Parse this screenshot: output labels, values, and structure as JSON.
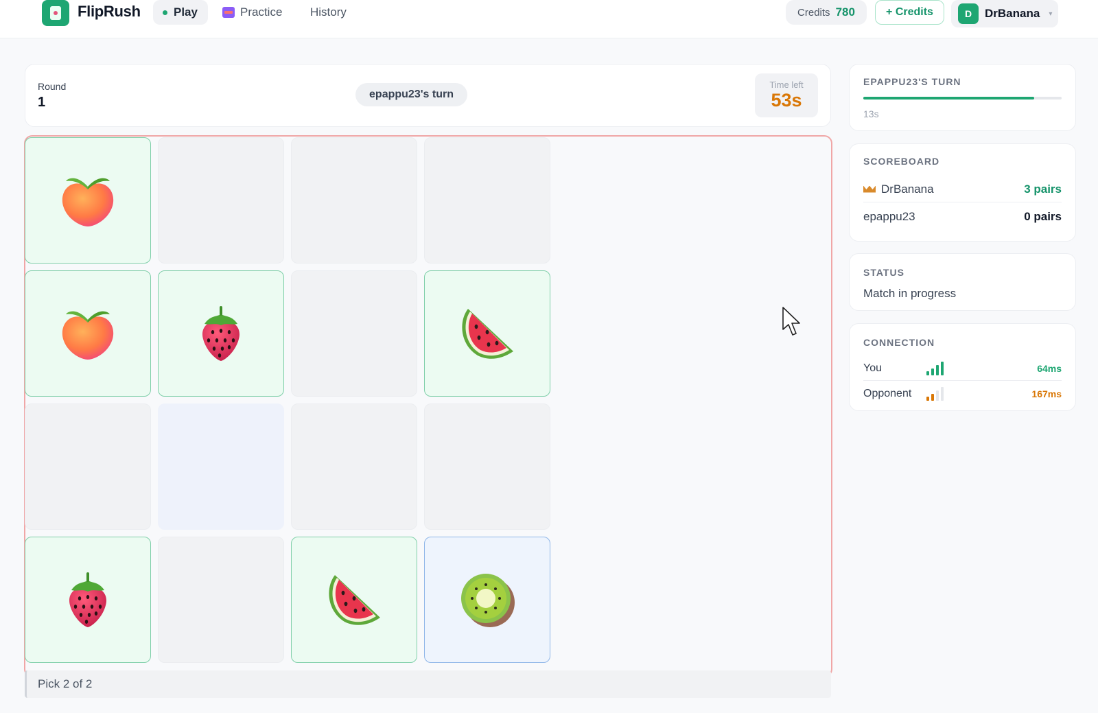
{
  "topbar": {
    "brand": "FlipRush",
    "nav": {
      "play": "Play",
      "practice": "Practice",
      "history": "History"
    },
    "credits_label": "Credits",
    "credits_value": "780",
    "add_credits_label": "+ Credits",
    "user_initial": "D",
    "user_name": "DrBanana"
  },
  "round": {
    "label": "Round",
    "value": "1",
    "turn": "epappu23's turn",
    "time_label": "Time left",
    "time_value": "53s"
  },
  "board": {
    "tiles": [
      {
        "state": "matched",
        "fruit": "peach"
      },
      {
        "state": "hidden"
      },
      {
        "state": "hidden"
      },
      {
        "state": "hidden"
      },
      {
        "state": "matched",
        "fruit": "peach"
      },
      {
        "state": "matched",
        "fruit": "strawberry"
      },
      {
        "state": "hidden"
      },
      {
        "state": "matched",
        "fruit": "watermelon"
      },
      {
        "state": "hidden"
      },
      {
        "state": "hover"
      },
      {
        "state": "hidden"
      },
      {
        "state": "hidden"
      },
      {
        "state": "matched",
        "fruit": "strawberry"
      },
      {
        "state": "hidden"
      },
      {
        "state": "matched",
        "fruit": "watermelon"
      },
      {
        "state": "selected",
        "fruit": "kiwi"
      }
    ],
    "pick_status": "Pick 2 of 2"
  },
  "sidebar": {
    "turn": {
      "title": "EPAPPU23'S TURN",
      "progress": 0.86,
      "seconds": "13s"
    },
    "scoreboard": {
      "title": "SCOREBOARD",
      "rows": [
        {
          "name": "DrBanana",
          "score": "3 pairs",
          "leader": true
        },
        {
          "name": "epappu23",
          "score": "0 pairs",
          "leader": false
        }
      ]
    },
    "status": {
      "title": "STATUS",
      "text": "Match in progress"
    },
    "connection": {
      "title": "CONNECTION",
      "rows": [
        {
          "label": "You",
          "latency": "64ms",
          "bars": 4,
          "color": "#1ea672"
        },
        {
          "label": "Opponent",
          "latency": "167ms",
          "bars": 2,
          "color": "#d97706"
        }
      ]
    }
  }
}
